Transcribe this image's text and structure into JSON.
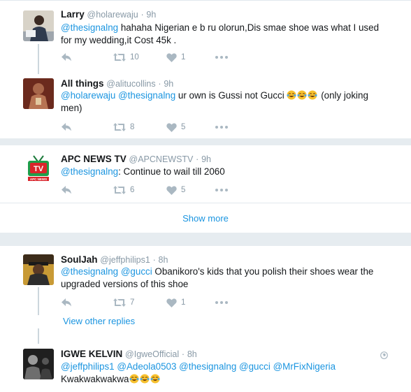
{
  "tweets": [
    {
      "name": "Larry",
      "handle": "@holarewaju",
      "time": "9h",
      "mentions": [
        "@thesignalng"
      ],
      "text": " hahaha Nigerian e b ru olorun,Dis smae shoe was what I used for my wedding,it Cost 45k .",
      "retweets": "10",
      "likes": "1"
    },
    {
      "name": "All things",
      "handle": "@alitucollins",
      "time": "9h",
      "mentions": [
        "@holarewaju",
        "@thesignalng"
      ],
      "text": " ur own is Gussi not Gucci",
      "text_after_emoji": " (only joking men)",
      "retweets": "8",
      "likes": "5"
    },
    {
      "name": "APC NEWS TV",
      "handle": "@APCNEWSTV",
      "time": "9h",
      "mentions": [
        "@thesignalng"
      ],
      "text": ": Continue to wail till 2060",
      "retweets": "6",
      "likes": "5",
      "avatar_text": "TV",
      "avatar_subtext": "APC NEWS"
    },
    {
      "name": "SoulJah",
      "handle": "@jeffphilips1",
      "time": "8h",
      "mentions": [
        "@thesignalng",
        "@gucci"
      ],
      "text": " Obanikoro's kids that you polish their shoes wear the upgraded versions of this shoe",
      "retweets": "7",
      "likes": "1"
    },
    {
      "name": "IGWE KELVIN",
      "handle": "@IgweOfficial",
      "time": "8h",
      "mentions": [
        "@jeffphilips1",
        "@Adeola0503",
        "@thesignalng",
        "@gucci",
        "@MrFixNigeria"
      ],
      "text": "Kwakwakwakwa"
    }
  ],
  "show_more_label": "Show more",
  "view_other_replies_label": "View other replies",
  "dot": "·",
  "icons": {
    "reply": "reply-icon",
    "retweet": "retweet-icon",
    "like": "heart-icon",
    "more": "more-icon",
    "emoji": "tears-of-joy-emoji"
  },
  "colors": {
    "link": "#1b95e0",
    "muted": "#8899a6",
    "icon": "#aab8c2",
    "separator": "#e6ecf0",
    "thread_line": "#ccd6dd"
  }
}
